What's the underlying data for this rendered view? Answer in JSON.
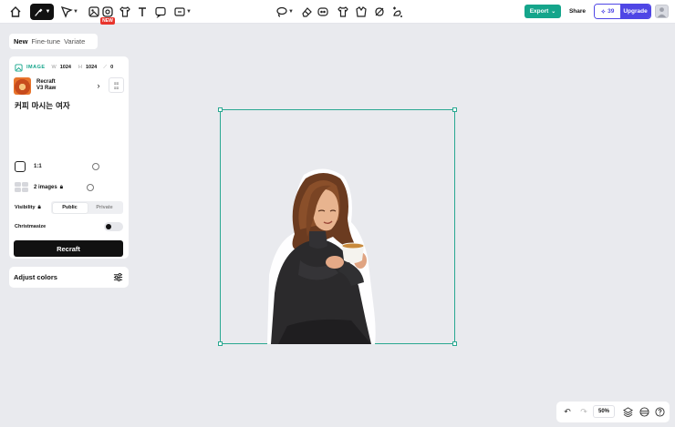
{
  "toolbar": {
    "tools": [
      "home-icon",
      "brush-tool-icon",
      "select-tool-icon",
      "image-tool-icon",
      "shirt-icon",
      "text-tool-icon",
      "comment-icon",
      "frame-tool-icon"
    ],
    "new_badge": "NEW",
    "context_tools": [
      "lasso-icon",
      "eraser-icon",
      "mask-icon",
      "shirt-icon",
      "creative-upscale-icon",
      "vectorize-icon",
      "magic-edit-icon"
    ],
    "export_label": "Export",
    "share_label": "Share",
    "credits": "39",
    "upgrade_label": "Upgrade"
  },
  "mode_tabs": [
    {
      "label": "New",
      "active": true
    },
    {
      "label": "Fine-tune",
      "active": false
    },
    {
      "label": "Variate",
      "active": false
    }
  ],
  "panel": {
    "type_label": "IMAGE",
    "width_key": "W",
    "width_value": "1024",
    "height_key": "H",
    "height_value": "1024",
    "count_value": "0",
    "model_line1": "Recraft",
    "model_line2": "V3 Raw",
    "prompt": "커피 마시는 여자",
    "aspect_ratio": "1:1",
    "images_count": "2 images",
    "visibility_label": "Visibility",
    "visibility_options": [
      "Public",
      "Private"
    ],
    "visibility_selected": "Public",
    "christmasize_label": "Christmasize",
    "christmasize_on": false,
    "recraft_button": "Recraft"
  },
  "adjust_colors_label": "Adjust colors",
  "zoom": {
    "value": "50%"
  },
  "colors": {
    "accent": "#15a58b",
    "brand": "#4f46e5",
    "badge": "#e8342c",
    "canvas": "#e9eaee"
  }
}
